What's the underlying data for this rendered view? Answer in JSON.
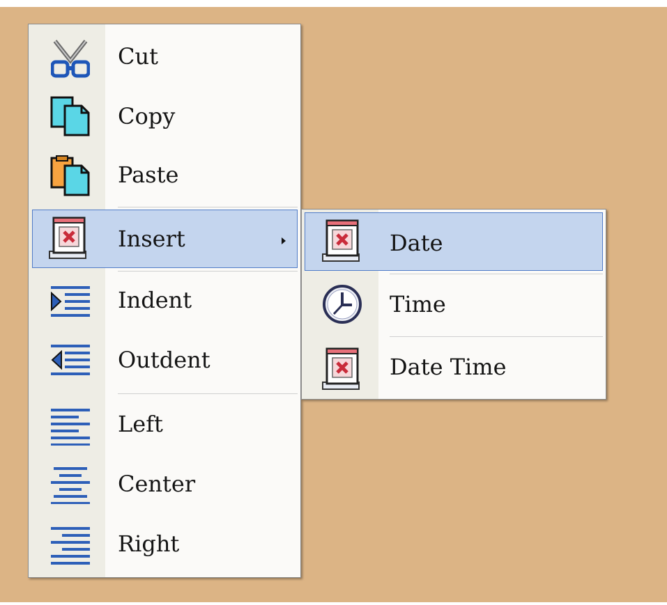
{
  "colors": {
    "background": "#dcb485",
    "highlight": "#c4d5ee",
    "highlight_border": "#4f7bc7"
  },
  "context_menu": {
    "items": [
      {
        "label": "Cut",
        "icon": "scissors-icon"
      },
      {
        "label": "Copy",
        "icon": "copy-icon"
      },
      {
        "label": "Paste",
        "icon": "paste-icon"
      },
      {
        "label": "Insert",
        "icon": "insert-date-icon",
        "submenu": true,
        "highlighted": true
      },
      {
        "label": "Indent",
        "icon": "indent-icon"
      },
      {
        "label": "Outdent",
        "icon": "outdent-icon"
      },
      {
        "label": "Left",
        "icon": "align-left-icon"
      },
      {
        "label": "Center",
        "icon": "align-center-icon"
      },
      {
        "label": "Right",
        "icon": "align-right-icon"
      }
    ]
  },
  "insert_submenu": {
    "items": [
      {
        "label": "Date",
        "icon": "insert-date-icon",
        "highlighted": true
      },
      {
        "label": "Time",
        "icon": "clock-icon"
      },
      {
        "label": "Date Time",
        "icon": "insert-date-icon"
      }
    ]
  }
}
